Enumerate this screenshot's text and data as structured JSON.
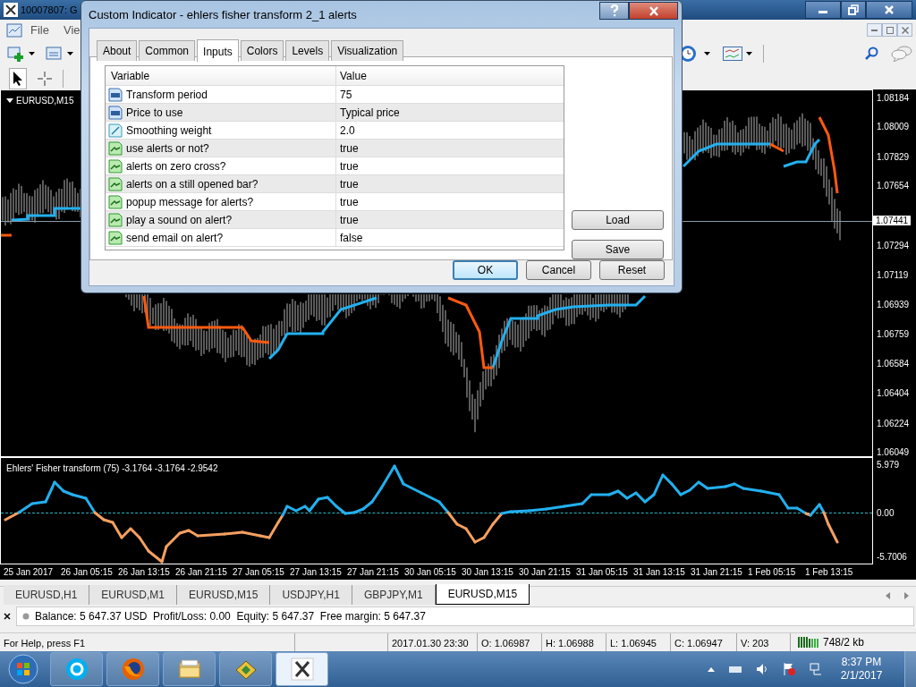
{
  "main_window": {
    "title": "10007807: G"
  },
  "menu": [
    {
      "label": "File"
    },
    {
      "label": "Vie"
    }
  ],
  "chart": {
    "symbol": "EURUSD,M15",
    "price_labels": [
      "1.08184",
      "1.08009",
      "1.07829",
      "1.07654",
      "1.07294",
      "1.07119",
      "1.06939",
      "1.06759",
      "1.06584",
      "1.06404",
      "1.06224",
      "1.06049"
    ],
    "current_price": "1.07441",
    "time_labels": [
      "25 Jan 2017",
      "26 Jan 05:15",
      "26 Jan 13:15",
      "26 Jan 21:15",
      "27 Jan 05:15",
      "27 Jan 13:15",
      "27 Jan 21:15",
      "30 Jan 05:15",
      "30 Jan 13:15",
      "30 Jan 21:15",
      "31 Jan 05:15",
      "31 Jan 13:15",
      "31 Jan 21:15",
      "1 Feb 05:15",
      "1 Feb 13:15"
    ]
  },
  "indicator": {
    "legend": "Ehlers' Fisher transform (75) -3.1764 -3.1764 -2.9542",
    "scale_labels": [
      "5.979",
      "0.00",
      "-5.7006"
    ]
  },
  "chart_tabs": [
    {
      "label": "EURUSD,H1",
      "selected": false
    },
    {
      "label": "EURUSD,M1",
      "selected": false
    },
    {
      "label": "EURUSD,M15",
      "selected": false
    },
    {
      "label": "USDJPY,H1",
      "selected": false
    },
    {
      "label": "GBPJPY,M1",
      "selected": false
    },
    {
      "label": "EURUSD,M15",
      "selected": true
    }
  ],
  "account_line": "Balance: 5 647.37 USD  Profit/Loss: 0.00  Equity: 5 647.37  Free margin: 5 647.37",
  "status_bar": {
    "help": "For Help, press F1",
    "cells": [
      "2017.01.30 23:30",
      "O: 1.06987",
      "H: 1.06988",
      "L: 1.06945",
      "C: 1.06947",
      "V: 203"
    ],
    "traffic": "748/2 kb"
  },
  "taskbar": {
    "apps": [
      {
        "kind": "skype",
        "active": false
      },
      {
        "kind": "browser",
        "active": false
      },
      {
        "kind": "folder",
        "active": false
      },
      {
        "kind": "book",
        "active": false
      },
      {
        "kind": "terminal",
        "active": true
      }
    ],
    "time": "8:37 PM",
    "date": "2/1/2017"
  },
  "dialog": {
    "title": "Custom Indicator - ehlers fisher transform 2_1 alerts",
    "tabs": [
      {
        "label": "About",
        "selected": false
      },
      {
        "label": "Common",
        "selected": false
      },
      {
        "label": "Inputs",
        "selected": true
      },
      {
        "label": "Colors",
        "selected": false
      },
      {
        "label": "Levels",
        "selected": false
      },
      {
        "label": "Visualization",
        "selected": false
      }
    ],
    "columns": [
      "Variable",
      "Value"
    ],
    "rows": [
      {
        "kind": "int",
        "variable": "Transform period",
        "value": "75"
      },
      {
        "kind": "int",
        "variable": "Price to use",
        "value": "Typical price"
      },
      {
        "kind": "double",
        "variable": "Smoothing weight",
        "value": "2.0"
      },
      {
        "kind": "bool",
        "variable": "use alerts or not?",
        "value": "true"
      },
      {
        "kind": "bool",
        "variable": "alerts on zero cross?",
        "value": "true"
      },
      {
        "kind": "bool",
        "variable": "alerts on a still opened bar?",
        "value": "true"
      },
      {
        "kind": "bool",
        "variable": "popup message for alerts?",
        "value": "true"
      },
      {
        "kind": "bool",
        "variable": "play a sound on alert?",
        "value": "true"
      },
      {
        "kind": "bool",
        "variable": "send email on alert?",
        "value": "false"
      }
    ],
    "side_buttons": [
      "Load",
      "Save"
    ],
    "buttons": [
      {
        "label": "OK",
        "default": true
      },
      {
        "label": "Cancel",
        "default": false
      },
      {
        "label": "Reset",
        "default": false
      }
    ]
  }
}
